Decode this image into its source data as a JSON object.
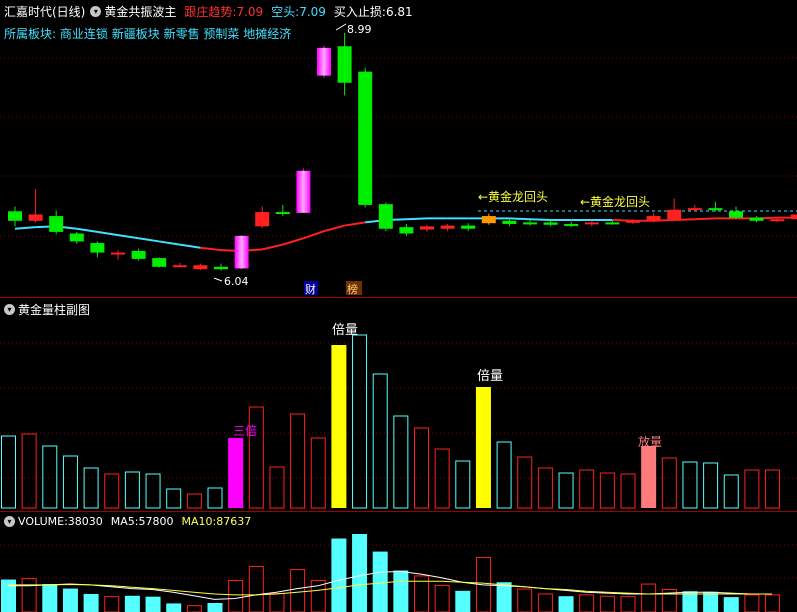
{
  "main": {
    "stock_name": "汇嘉时代(日线)",
    "indicator_name": "黄金共振波主",
    "trend_label": "跟庄趋势: ",
    "trend_value": "7.09",
    "short_label": "空头: ",
    "short_value": "7.09",
    "stop_label": "买入止损: ",
    "stop_value": "6.81",
    "sector_label": "所属板块:",
    "sectors": [
      "商业连锁",
      "新疆板块",
      "新零售",
      "预制菜",
      "地摊经济"
    ],
    "high_label": "8.99",
    "low_label": "6.04",
    "signal_1": "←黄金龙回头",
    "signal_2": "←黄金龙回头",
    "badge_cai": "财",
    "badge_bang": "榜"
  },
  "volume_pattern": {
    "title": "黄金量柱副图",
    "label_sanbei": "三倍",
    "label_beiliang_1": "倍量",
    "label_beiliang_2": "倍量",
    "label_fangliang": "放量"
  },
  "volume": {
    "volume_label": "VOLUME: ",
    "volume_value": "38030",
    "ma5_label": "MA5: ",
    "ma5_value": "57800",
    "ma10_label": "MA10: ",
    "ma10_value": "87637"
  },
  "colors": {
    "up": "#ff2020",
    "down": "#00ee00",
    "magenta": "#ff00ff",
    "cyan": "#55ffff",
    "yellow": "#ffff00",
    "salmon": "#ff7a7a",
    "ma_cyan": "#40e0ff",
    "ma_red": "#ff2020"
  },
  "candles": [
    {
      "o": 6.74,
      "c": 6.62,
      "h": 6.8,
      "l": 6.55,
      "t": "down"
    },
    {
      "o": 6.62,
      "c": 6.7,
      "h": 7.02,
      "l": 6.6,
      "t": "up"
    },
    {
      "o": 6.68,
      "c": 6.48,
      "h": 6.75,
      "l": 6.45,
      "t": "down"
    },
    {
      "o": 6.46,
      "c": 6.36,
      "h": 6.48,
      "l": 6.33,
      "t": "down"
    },
    {
      "o": 6.34,
      "c": 6.22,
      "h": 6.36,
      "l": 6.16,
      "t": "down"
    },
    {
      "o": 6.2,
      "c": 6.22,
      "h": 6.25,
      "l": 6.13,
      "t": "cross"
    },
    {
      "o": 6.24,
      "c": 6.14,
      "h": 6.27,
      "l": 6.12,
      "t": "down"
    },
    {
      "o": 6.15,
      "c": 6.04,
      "h": 6.16,
      "l": 6.03,
      "t": "down"
    },
    {
      "o": 6.06,
      "c": 6.06,
      "h": 6.09,
      "l": 6.04,
      "t": "cross"
    },
    {
      "o": 6.06,
      "c": 6.01,
      "h": 6.08,
      "l": 6.0,
      "t": "up"
    },
    {
      "o": 6.04,
      "c": 6.01,
      "h": 6.08,
      "l": 5.99,
      "t": "down"
    },
    {
      "o": 6.02,
      "c": 6.43,
      "h": 6.44,
      "l": 6.01,
      "t": "magenta"
    },
    {
      "o": 6.55,
      "c": 6.73,
      "h": 6.8,
      "l": 6.53,
      "t": "up"
    },
    {
      "o": 6.73,
      "c": 6.71,
      "h": 6.82,
      "l": 6.68,
      "t": "cross"
    },
    {
      "o": 6.72,
      "c": 7.25,
      "h": 7.28,
      "l": 6.72,
      "t": "magenta"
    },
    {
      "o": 8.45,
      "c": 8.8,
      "h": 8.83,
      "l": 8.42,
      "t": "magenta"
    },
    {
      "o": 8.82,
      "c": 8.36,
      "h": 8.99,
      "l": 8.2,
      "t": "down"
    },
    {
      "o": 8.5,
      "c": 6.82,
      "h": 8.55,
      "l": 6.79,
      "t": "down"
    },
    {
      "o": 6.83,
      "c": 6.52,
      "h": 6.85,
      "l": 6.49,
      "t": "down"
    },
    {
      "o": 6.54,
      "c": 6.46,
      "h": 6.58,
      "l": 6.43,
      "t": "down"
    },
    {
      "o": 6.51,
      "c": 6.55,
      "h": 6.57,
      "l": 6.48,
      "t": "up"
    },
    {
      "o": 6.52,
      "c": 6.56,
      "h": 6.58,
      "l": 6.49,
      "t": "up"
    },
    {
      "o": 6.56,
      "c": 6.52,
      "h": 6.59,
      "l": 6.49,
      "t": "down"
    },
    {
      "o": 6.59,
      "c": 6.68,
      "h": 6.71,
      "l": 6.57,
      "t": "orange"
    },
    {
      "o": 6.62,
      "c": 6.58,
      "h": 6.65,
      "l": 6.55,
      "t": "down"
    },
    {
      "o": 6.6,
      "c": 6.59,
      "h": 6.63,
      "l": 6.56,
      "t": "cross"
    },
    {
      "o": 6.6,
      "c": 6.57,
      "h": 6.63,
      "l": 6.55,
      "t": "down"
    },
    {
      "o": 6.58,
      "c": 6.56,
      "h": 6.61,
      "l": 6.54,
      "t": "cross"
    },
    {
      "o": 6.58,
      "c": 6.6,
      "h": 6.62,
      "l": 6.55,
      "t": "up"
    },
    {
      "o": 6.6,
      "c": 6.59,
      "h": 6.62,
      "l": 6.57,
      "t": "cross"
    },
    {
      "o": 6.6,
      "c": 6.62,
      "h": 6.64,
      "l": 6.58,
      "t": "up"
    },
    {
      "o": 6.62,
      "c": 6.68,
      "h": 6.72,
      "l": 6.6,
      "t": "up"
    },
    {
      "o": 6.64,
      "c": 6.76,
      "h": 6.9,
      "l": 6.62,
      "t": "up"
    },
    {
      "o": 6.76,
      "c": 6.78,
      "h": 6.82,
      "l": 6.74,
      "t": "up"
    },
    {
      "o": 6.78,
      "c": 6.76,
      "h": 6.86,
      "l": 6.74,
      "t": "cross"
    },
    {
      "o": 6.74,
      "c": 6.66,
      "h": 6.8,
      "l": 6.64,
      "t": "down"
    },
    {
      "o": 6.66,
      "c": 6.62,
      "h": 6.68,
      "l": 6.6,
      "t": "down"
    },
    {
      "o": 6.62,
      "c": 6.64,
      "h": 6.66,
      "l": 6.6,
      "t": "up"
    },
    {
      "o": 6.64,
      "c": 6.7,
      "h": 6.72,
      "l": 6.62,
      "t": "up"
    }
  ],
  "ma_line": [
    6.52,
    6.54,
    6.55,
    6.52,
    6.48,
    6.44,
    6.4,
    6.36,
    6.32,
    6.28,
    6.25,
    6.24,
    6.26,
    6.32,
    6.4,
    6.49,
    6.56,
    6.6,
    6.63,
    6.64,
    6.65,
    6.65,
    6.65,
    6.65,
    6.65,
    6.64,
    6.63,
    6.63,
    6.63,
    6.63,
    6.62,
    6.62,
    6.63,
    6.64,
    6.65,
    6.65,
    6.65,
    6.66,
    6.66
  ],
  "vol_bars": [
    {
      "v": 72,
      "t": "cyan"
    },
    {
      "v": 74,
      "t": "red"
    },
    {
      "v": 62,
      "t": "cyan"
    },
    {
      "v": 52,
      "t": "cyan"
    },
    {
      "v": 40,
      "t": "cyan"
    },
    {
      "v": 34,
      "t": "red"
    },
    {
      "v": 36,
      "t": "cyan"
    },
    {
      "v": 34,
      "t": "cyan"
    },
    {
      "v": 19,
      "t": "cyan"
    },
    {
      "v": 14,
      "t": "red"
    },
    {
      "v": 20,
      "t": "cyan"
    },
    {
      "v": 70,
      "t": "magenta"
    },
    {
      "v": 101,
      "t": "red"
    },
    {
      "v": 41,
      "t": "red"
    },
    {
      "v": 94,
      "t": "red"
    },
    {
      "v": 70,
      "t": "red"
    },
    {
      "v": 163,
      "t": "yellow"
    },
    {
      "v": 173,
      "t": "cyan"
    },
    {
      "v": 134,
      "t": "cyan"
    },
    {
      "v": 92,
      "t": "cyan"
    },
    {
      "v": 80,
      "t": "red"
    },
    {
      "v": 59,
      "t": "red"
    },
    {
      "v": 47,
      "t": "cyan"
    },
    {
      "v": 121,
      "t": "yellow"
    },
    {
      "v": 66,
      "t": "cyan"
    },
    {
      "v": 51,
      "t": "red"
    },
    {
      "v": 40,
      "t": "red"
    },
    {
      "v": 35,
      "t": "cyan"
    },
    {
      "v": 38,
      "t": "red"
    },
    {
      "v": 35,
      "t": "red"
    },
    {
      "v": 34,
      "t": "red"
    },
    {
      "v": 62,
      "t": "salmon"
    },
    {
      "v": 50,
      "t": "red"
    },
    {
      "v": 46,
      "t": "cyan"
    },
    {
      "v": 45,
      "t": "cyan"
    },
    {
      "v": 33,
      "t": "cyan"
    },
    {
      "v": 38,
      "t": "red"
    },
    {
      "v": 38,
      "t": "red"
    }
  ],
  "vol_ma5": [
    58,
    58,
    60,
    62,
    60,
    56,
    52,
    50,
    44,
    36,
    28,
    30,
    38,
    44,
    52,
    58,
    70,
    80,
    88,
    90,
    84,
    76,
    66,
    60,
    58,
    56,
    52,
    48,
    44,
    42,
    40,
    40,
    42,
    44,
    44,
    42,
    40,
    40
  ],
  "vol_ma10": [
    60,
    60,
    60,
    61,
    60,
    58,
    55,
    52,
    48,
    44,
    40,
    38,
    38,
    40,
    44,
    48,
    54,
    60,
    64,
    68,
    68,
    68,
    66,
    64,
    60,
    56,
    52,
    50,
    46,
    44,
    42,
    40,
    40,
    40,
    40,
    40,
    40,
    40
  ]
}
